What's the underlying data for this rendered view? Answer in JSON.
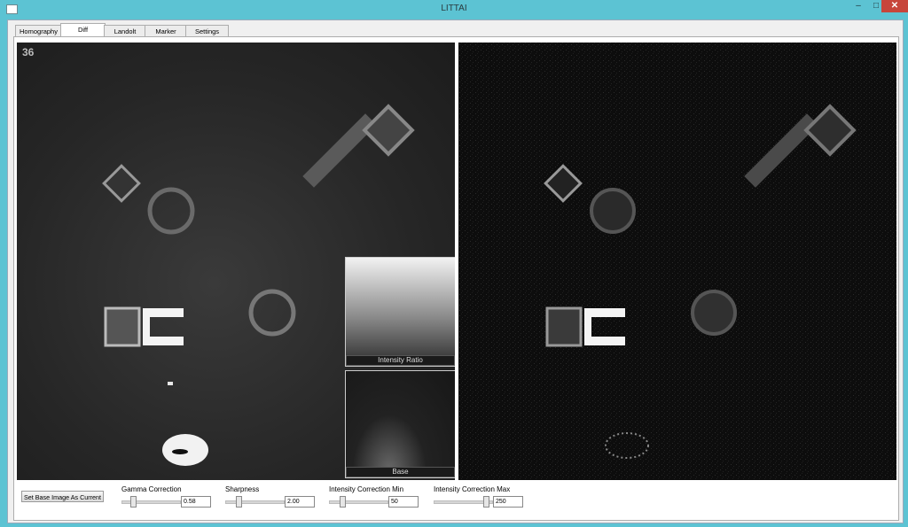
{
  "window": {
    "title": "LITTAI"
  },
  "tabs": [
    {
      "label": "Homography",
      "active": false
    },
    {
      "label": "Diff",
      "active": true
    },
    {
      "label": "Landolt",
      "active": false
    },
    {
      "label": "Marker",
      "active": false
    },
    {
      "label": "Settings",
      "active": false
    }
  ],
  "view": {
    "frame_number": "36"
  },
  "subviews": {
    "ratio_label": "Intensity Ratio",
    "base_label": "Base"
  },
  "controls": {
    "set_base_label": "Set Base Image As Current",
    "sliders": [
      {
        "label": "Gamma Correction",
        "value": "0.58",
        "fraction": 0.15
      },
      {
        "label": "Sharpness",
        "value": "2.00",
        "fraction": 0.2
      },
      {
        "label": "Intensity Correction Min",
        "value": "50",
        "fraction": 0.2
      },
      {
        "label": "Intensity Correction Max",
        "value": "250",
        "fraction": 0.95
      }
    ]
  },
  "colors": {
    "titlebar": "#5cc3d3",
    "close": "#c7453b"
  },
  "icons": {
    "app": "app-window-icon",
    "minimize": "minimize-icon",
    "maximize": "maximize-icon",
    "close": "close-icon"
  }
}
